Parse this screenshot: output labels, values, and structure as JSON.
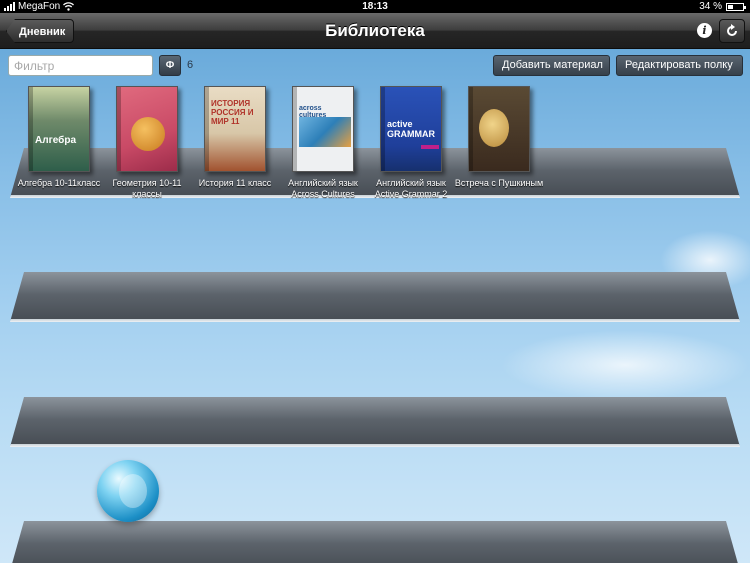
{
  "status_bar": {
    "carrier": "MegaFon",
    "time": "18:13",
    "battery": "34 %",
    "battery_level": 0.34
  },
  "nav": {
    "back_label": "Дневник",
    "title": "Библиотека"
  },
  "toolbar": {
    "filter_placeholder": "Фильтр",
    "filter_button": "Ф",
    "count": "6",
    "add_label": "Добавить материал",
    "edit_label": "Редактировать полку"
  },
  "books": [
    {
      "label": "Алгебра 10-11класс",
      "cover_text": "Алгебра",
      "cover_color": "#2e5e4a",
      "cover_accent": "#c7d3a3"
    },
    {
      "label": "Геометрия 10-11 классы",
      "cover_text": "",
      "cover_color": "#c94a66",
      "cover_accent": "#e08a2a"
    },
    {
      "label": "История 11 класс",
      "cover_text": "ИСТОРИЯ РОССИЯ И МИР 11",
      "cover_color": "#d8c7a8",
      "cover_accent": "#b0332a"
    },
    {
      "label": "Английский язык Across Cultures",
      "cover_text": "across cultures",
      "cover_color": "#eef0f2",
      "cover_accent": "#2d7fb8"
    },
    {
      "label": "Английский язык Active Grammar 2",
      "cover_text": "active GRAMMAR",
      "cover_color": "#1f3f9a",
      "cover_accent": "#c0208a"
    },
    {
      "label": "Встреча с Пушкиным",
      "cover_text": "",
      "cover_color": "#3a2a1e",
      "cover_accent": "#d9b46a"
    }
  ]
}
